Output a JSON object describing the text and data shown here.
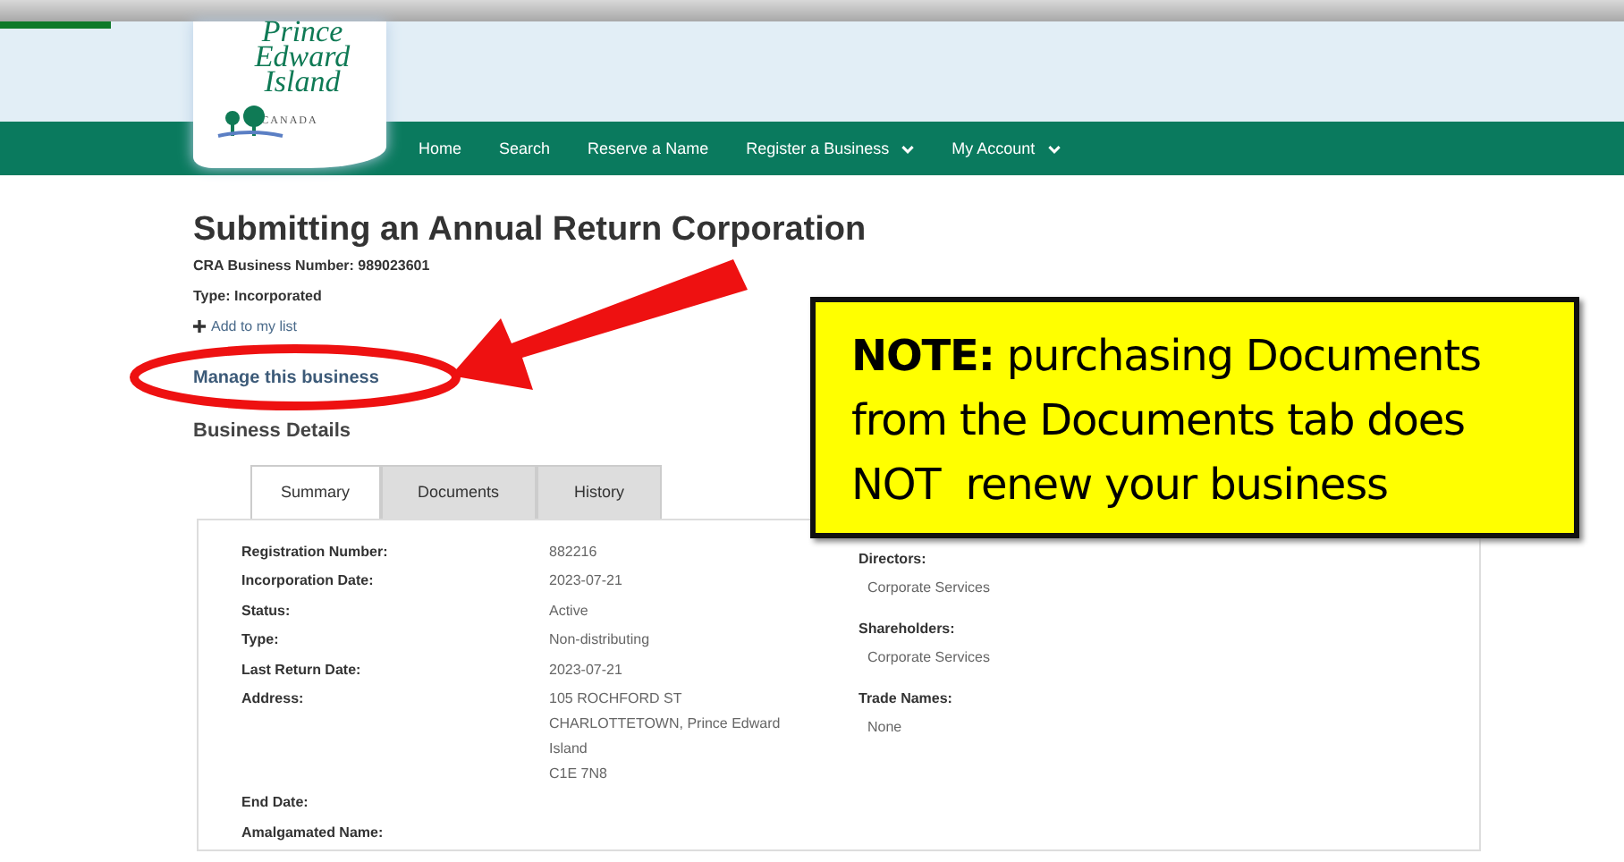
{
  "logo": {
    "name": "Prince Edward Island",
    "country": "CANADA"
  },
  "nav": [
    {
      "label": "Home",
      "dropdown": false
    },
    {
      "label": "Search",
      "dropdown": false
    },
    {
      "label": "Reserve a Name",
      "dropdown": false
    },
    {
      "label": "Register a Business",
      "dropdown": true
    },
    {
      "label": "My Account",
      "dropdown": true
    }
  ],
  "page": {
    "title": "Submitting an Annual Return Corporation",
    "cra": "CRA Business Number: 989023601",
    "type": "Type: Incorporated",
    "add_link": "Add to my list",
    "manage_link": "Manage this business",
    "section": "Business Details"
  },
  "tabs": [
    {
      "label": "Summary",
      "selected": true
    },
    {
      "label": "Documents",
      "selected": false
    },
    {
      "label": "History",
      "selected": false
    }
  ],
  "details": [
    {
      "label": "Registration Number:",
      "value": [
        "882216"
      ]
    },
    {
      "label": "Incorporation Date:",
      "value": [
        "2023-07-21"
      ]
    },
    {
      "label": "Status:",
      "value": [
        "Active"
      ]
    },
    {
      "label": "Type:",
      "value": [
        "Non-distributing"
      ]
    },
    {
      "label": "Last Return Date:",
      "value": [
        "2023-07-21"
      ]
    },
    {
      "label": "Address:",
      "value": [
        "105 ROCHFORD ST",
        "CHARLOTTETOWN, Prince Edward",
        "Island",
        "C1E 7N8"
      ]
    },
    {
      "label": "End Date:"
    },
    {
      "label": "Amalgamated Name:"
    }
  ],
  "side": [
    {
      "heading": "Directors:",
      "value": "Corporate Services"
    },
    {
      "heading": "Shareholders:",
      "value": "Corporate Services"
    },
    {
      "heading": "Trade Names:",
      "value": "None"
    }
  ],
  "note": "**NOTE:** purchasing Documents\nfrom the Documents tab does\nNOT  renew your business"
}
